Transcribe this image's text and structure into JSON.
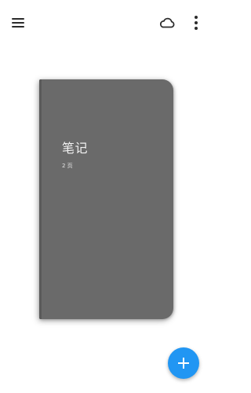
{
  "toolbar": {
    "menu_icon": "hamburger-menu-icon",
    "sync_icon": "cloud-icon",
    "more_icon": "more-vertical-icon"
  },
  "notebook": {
    "title": "笔记",
    "page_count": "2 页",
    "cover_color": "#6a6a6a"
  },
  "fab": {
    "icon": "plus-icon",
    "color": "#2196f3"
  }
}
